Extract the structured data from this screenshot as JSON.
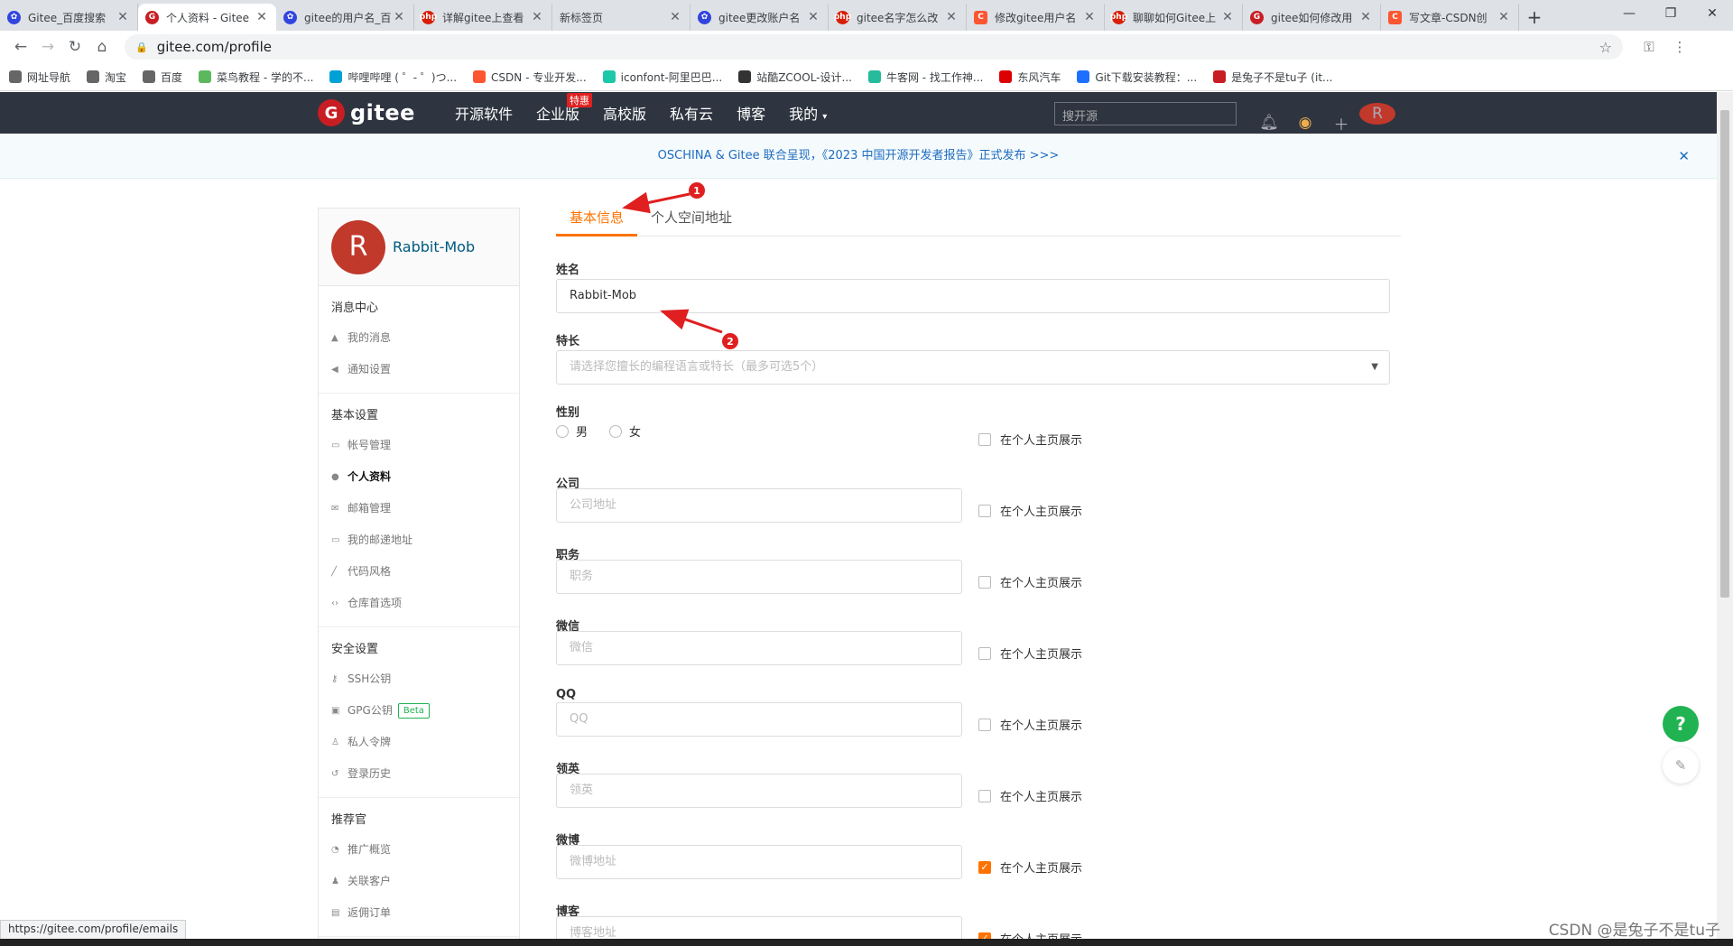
{
  "browser": {
    "tabs": [
      {
        "title": "Gitee_百度搜索",
        "fav": "baidu",
        "active": false
      },
      {
        "title": "个人资料 - Gitee",
        "fav": "gitee",
        "active": true
      },
      {
        "title": "gitee的用户名_百",
        "fav": "baidu",
        "active": false
      },
      {
        "title": "详解gitee上查看",
        "fav": "php",
        "active": false
      },
      {
        "title": "新标签页",
        "fav": "none",
        "active": false
      },
      {
        "title": "gitee更改账户名",
        "fav": "baidu",
        "active": false
      },
      {
        "title": "gitee名字怎么改",
        "fav": "php",
        "active": false
      },
      {
        "title": "修改gitee用户名",
        "fav": "csdn",
        "active": false
      },
      {
        "title": "聊聊如何Gitee上",
        "fav": "php",
        "active": false
      },
      {
        "title": "gitee如何修改用",
        "fav": "gitee",
        "active": false
      },
      {
        "title": "写文章-CSDN创",
        "fav": "csdn",
        "active": false
      }
    ],
    "url": "gitee.com/profile",
    "bookmarks": [
      {
        "label": "网址导航",
        "color": "#666"
      },
      {
        "label": "淘宝",
        "color": "#666"
      },
      {
        "label": "百度",
        "color": "#666"
      },
      {
        "label": "菜鸟教程 - 学的不...",
        "color": "#5cb85c"
      },
      {
        "label": "哔哩哔哩 ( ゜- ゜)つ...",
        "color": "#00a1d6"
      },
      {
        "label": "CSDN - 专业开发...",
        "color": "#fc5531"
      },
      {
        "label": "iconfont-阿里巴巴...",
        "color": "#1dc8a8"
      },
      {
        "label": "站酷ZCOOL-设计...",
        "color": "#333"
      },
      {
        "label": "牛客网 - 找工作神...",
        "color": "#25bb9b"
      },
      {
        "label": "东风汽车",
        "color": "#d00"
      },
      {
        "label": "Git下载安装教程：...",
        "color": "#1e6fff"
      },
      {
        "label": "是兔子不是tu子 (it...",
        "color": "#c71d23"
      }
    ]
  },
  "gitee_header": {
    "logo_text": "gitee",
    "nav": [
      "开源软件",
      "企业版",
      "高校版",
      "私有云",
      "博客",
      "我的"
    ],
    "enterprise_badge": "特惠",
    "search_placeholder": "搜开源",
    "avatar_letter": "R"
  },
  "notice": "OSCHINA & Gitee 联合呈现，《2023 中国开源开发者报告》正式发布 >>>",
  "sidebar": {
    "avatar_letter": "R",
    "username": "Rabbit-Mob",
    "groups": [
      {
        "title": "消息中心",
        "items": [
          {
            "label": "我的消息",
            "icon": "bell-icon"
          },
          {
            "label": "通知设置",
            "icon": "speaker-icon"
          }
        ]
      },
      {
        "title": "基本设置",
        "items": [
          {
            "label": "帐号管理",
            "icon": "card-icon"
          },
          {
            "label": "个人资料",
            "icon": "user-icon",
            "active": true
          },
          {
            "label": "邮箱管理",
            "icon": "mail-icon"
          },
          {
            "label": "我的邮递地址",
            "icon": "card-icon"
          },
          {
            "label": "代码风格",
            "icon": "brush-icon"
          },
          {
            "label": "仓库首选项",
            "icon": "code-icon"
          }
        ]
      },
      {
        "title": "安全设置",
        "items": [
          {
            "label": "SSH公钥",
            "icon": "key-icon"
          },
          {
            "label": "GPG公钥",
            "icon": "lock-icon",
            "badge": "Beta"
          },
          {
            "label": "私人令牌",
            "icon": "token-icon"
          },
          {
            "label": "登录历史",
            "icon": "history-icon"
          }
        ]
      },
      {
        "title": "推荐官",
        "items": [
          {
            "label": "推广概览",
            "icon": "chart-icon"
          },
          {
            "label": "关联客户",
            "icon": "users-icon"
          },
          {
            "label": "返佣订单",
            "icon": "order-icon"
          }
        ]
      }
    ]
  },
  "form": {
    "tabs": [
      "基本信息",
      "个人空间地址"
    ],
    "name_label": "姓名",
    "name_value": "Rabbit-Mob",
    "skills_label": "特长",
    "skills_placeholder": "请选择您擅长的编程语言或特长（最多可选5个）",
    "gender_label": "性别",
    "gender_options": [
      "男",
      "女"
    ],
    "show_label": "在个人主页展示",
    "fields": [
      {
        "label": "公司",
        "placeholder": "公司地址",
        "show": false
      },
      {
        "label": "职务",
        "placeholder": "职务",
        "show": false
      },
      {
        "label": "微信",
        "placeholder": "微信",
        "show": false
      },
      {
        "label": "QQ",
        "placeholder": "QQ",
        "show": false
      },
      {
        "label": "领英",
        "placeholder": "领英",
        "show": false
      },
      {
        "label": "微博",
        "placeholder": "微博地址",
        "show": true
      },
      {
        "label": "博客",
        "placeholder": "博客地址",
        "show": true
      }
    ]
  },
  "annotations": [
    "1",
    "2"
  ],
  "status_url": "https://gitee.com/profile/emails",
  "watermark": "CSDN @是兔子不是tu子",
  "help_label": "?",
  "colors": {
    "accent": "#fe7300",
    "header_bg": "#2e3540",
    "gitee_red": "#c71d23",
    "link_blue": "#005980"
  }
}
